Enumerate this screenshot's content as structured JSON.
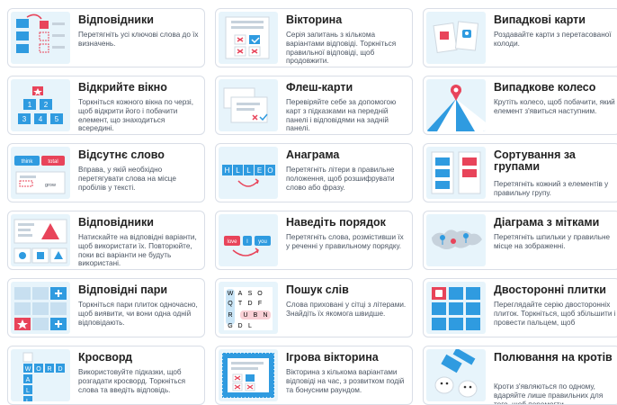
{
  "colors": {
    "accent_blue": "#2f9be0",
    "accent_red": "#e8445a",
    "thumb_bg": "#e7f4fb",
    "card_border": "#d9dee7"
  },
  "cards": [
    {
      "title": "Відповідники",
      "desc": "Перетягніть усі ключові слова до їх визначень.",
      "icon": "match-up-icon"
    },
    {
      "title": "Вікторина",
      "desc": "Серія запитань з кількома варіантами відповіді. Торкніться правильної відповіді, щоб продовжити.",
      "icon": "quiz-icon"
    },
    {
      "title": "Випадкові карти",
      "desc": "Роздавайте карти з перетасованої колоди.",
      "icon": "random-cards-icon"
    },
    {
      "title": "Відкрийте вікно",
      "desc": "Торкніться кожного вікна по черзі, щоб відкрити його і побачити елемент, що знаходиться всередині.",
      "icon": "open-box-icon"
    },
    {
      "title": "Флеш-карти",
      "desc": "Перевіряйте себе за допомогою карт з підказками на передній панелі і відповідями на задній панелі.",
      "icon": "flash-cards-icon"
    },
    {
      "title": "Випадкове колесо",
      "desc": "Крутіть колесо, щоб побачити, який елемент з'явиться наступним.",
      "icon": "random-wheel-icon"
    },
    {
      "title": "Відсутнє слово",
      "desc": "Вправа, у якій необхідно перетягувати слова на місце пробілів у тексті.",
      "icon": "missing-word-icon"
    },
    {
      "title": "Анаграма",
      "desc": "Перетягніть літери в правильне положення, щоб розшифрувати слово або фразу.",
      "icon": "anagram-icon"
    },
    {
      "title": "Сортування за групами",
      "desc": "Перетягніть кожний з елементів у правильну групу.",
      "icon": "group-sort-icon"
    },
    {
      "title": "Відповідники",
      "desc": "Натискайте на відповідні варіанти, щоб використати їх. Повторюйте, поки всі варіанти не будуть використані.",
      "icon": "find-match-icon"
    },
    {
      "title": "Наведіть порядок",
      "desc": "Перетягніть слова, розмістивши їх у реченні у правильному порядку.",
      "icon": "unjumble-icon"
    },
    {
      "title": "Діаграма з мітками",
      "desc": "Перетягніть шпильки у правильне місце на зображенні.",
      "icon": "labelled-diagram-icon"
    },
    {
      "title": "Відповідні пари",
      "desc": "Торкніться пари плиток одночасно, щоб виявити, чи вони одна одній відповідають.",
      "icon": "matching-pairs-icon"
    },
    {
      "title": "Пошук слів",
      "desc": "Слова приховані у сітці з літерами. Знайдіть їх якомога швидше.",
      "icon": "wordsearch-icon"
    },
    {
      "title": "Двосторонні плитки",
      "desc": "Переглядайте серію двосторонніх плиток. Торкніться, щоб збільшити і провести пальцем, щоб",
      "icon": "flip-tiles-icon"
    },
    {
      "title": "Кросворд",
      "desc": "Використовуйте підказки, щоб розгадати кросворд. Торкніться слова та введіть відповідь.",
      "icon": "crossword-icon"
    },
    {
      "title": "Ігрова вікторина",
      "desc": "Вікторина з кількома варіантами відповіді на час, з розвитком подій та бонусним раундом.",
      "icon": "gameshow-quiz-icon"
    },
    {
      "title": "Полювання на кротів",
      "desc": "Кроти з'являються по одному, вдаряйте лише правильних для того, щоб перемогти.",
      "icon": "whack-a-mole-icon"
    }
  ],
  "thumb_text": {
    "anagram_letters": [
      "H",
      "L",
      "L",
      "E",
      "O"
    ],
    "missing_word_words": [
      "think",
      "total",
      "grow"
    ],
    "unjumble_words": [
      "love",
      "I",
      "you"
    ],
    "wordsearch_letters": [
      "W",
      "A",
      "S",
      "O",
      "Q",
      "T",
      "D",
      "F",
      "R",
      "U",
      "B",
      "N",
      "G",
      "D",
      "L"
    ],
    "crossword_letters": [
      "W",
      "O",
      "R",
      "D",
      "A",
      "L",
      "L"
    ]
  }
}
